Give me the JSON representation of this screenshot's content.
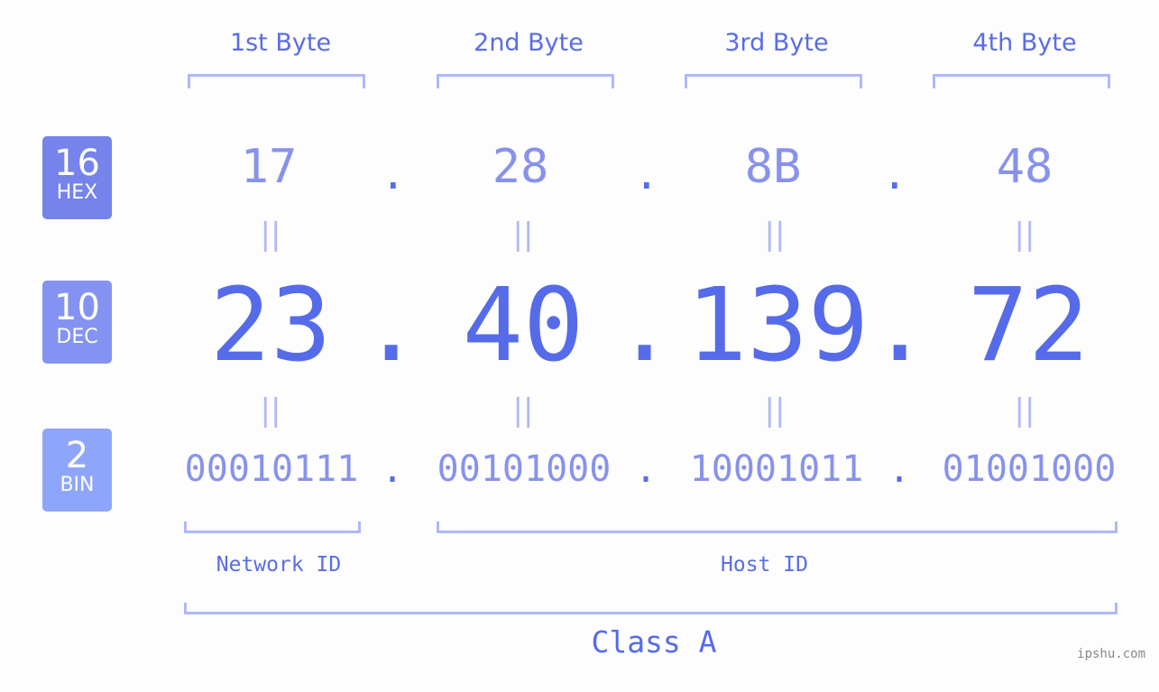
{
  "byte_headers": [
    "1st Byte",
    "2nd Byte",
    "3rd Byte",
    "4th Byte"
  ],
  "badges": [
    {
      "number": "16",
      "label": "HEX",
      "color": "#7583eb"
    },
    {
      "number": "10",
      "label": "DEC",
      "color": "#8493f2"
    },
    {
      "number": "2",
      "label": "BIN",
      "color": "#8ea6fa"
    }
  ],
  "hex_values": [
    "17",
    "28",
    "8B",
    "48"
  ],
  "dec_values": [
    "23",
    "40",
    "139",
    "72"
  ],
  "bin_values": [
    "00010111",
    "00101000",
    "10001011",
    "01001000"
  ],
  "separator": ".",
  "equals_sign": "||",
  "network_id_label": "Network ID",
  "host_id_label": "Host ID",
  "class_label": "Class A",
  "watermark": "ipshu.com",
  "colors": {
    "primary": "#566bea",
    "light": "#8892ec",
    "bracket": "#b0b9f6"
  }
}
